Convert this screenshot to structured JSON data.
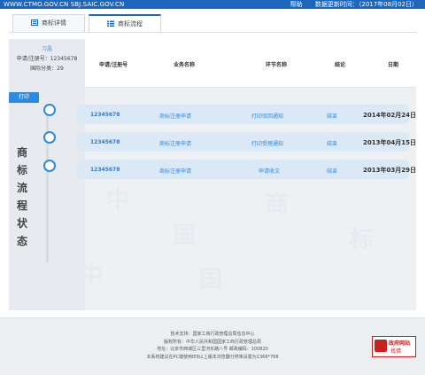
{
  "topbar": {
    "url": "WWW.CTMO.GOV.CN SBJ.SAIC.GOV.CN",
    "help": "帮助",
    "update_label": "数据更新时间：（2017年08月02日）"
  },
  "tabs": [
    {
      "label": "商标详情",
      "icon": "document-icon"
    },
    {
      "label": "商标流程",
      "icon": "list-icon"
    }
  ],
  "applicant": {
    "name": "习晶",
    "reg_no": "申请/注册号：12345678",
    "class": "国际分类：29"
  },
  "table_headers": {
    "reg_no": "申请/注册号",
    "business": "业务名称",
    "step": "环节名称",
    "result": "结论",
    "date": "日期"
  },
  "print_button": "打印",
  "status_vertical": [
    "商",
    "标",
    "流",
    "程",
    "状",
    "态"
  ],
  "rows": [
    {
      "reg_no": "12345678",
      "business": "商标注册申请",
      "step": "打印驳回通知",
      "result": "结束",
      "date": "2014年02月24日"
    },
    {
      "reg_no": "12345678",
      "business": "商标注册申请",
      "step": "打印受理通知",
      "result": "结束",
      "date": "2013年04月15日"
    },
    {
      "reg_no": "12345678",
      "business": "商标注册申请",
      "step": "申请收文",
      "result": "结束",
      "date": "2013年03月29日"
    }
  ],
  "footer": {
    "lines": [
      "技术支持：国家工商行政管理总局信息中心",
      "版权所有：中华人民共和国国家工商行政管理总局",
      "地址：北京市西城区三里河东路八号 邮政编码：100820",
      "本系统建议在PC端使用IE8以上版本浏览器分辨率设置为1366*768"
    ],
    "badge_line1": "政府网站",
    "badge_line2": "找错"
  },
  "colors": {
    "topbar": "#1e66b9",
    "accent": "#2c8be0",
    "row_bg": "#dbe9f6",
    "footer_bg": "#eceff2"
  }
}
